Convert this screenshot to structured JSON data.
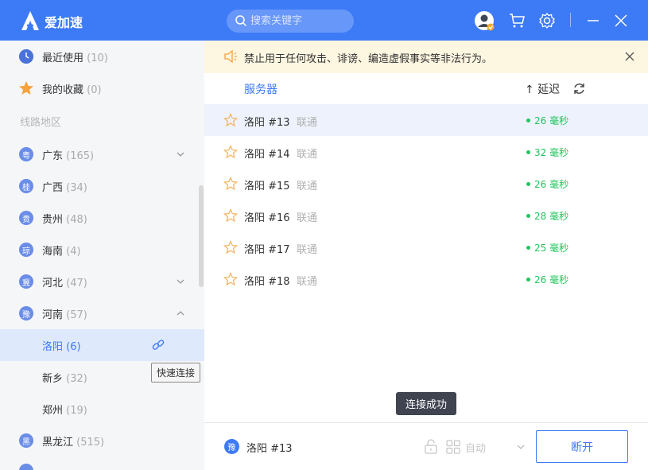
{
  "app": {
    "name": "爱加速"
  },
  "search": {
    "placeholder": "搜索关键字"
  },
  "sidebar": {
    "recent": {
      "label": "最近使用",
      "count": "(10)"
    },
    "favorites": {
      "label": "我的收藏",
      "count": "(0)"
    },
    "section_title": "线路地区",
    "regions": [
      {
        "badge": "粤",
        "label": "广东",
        "count": "(165)"
      },
      {
        "badge": "桂",
        "label": "广西",
        "count": "(34)"
      },
      {
        "badge": "贵",
        "label": "贵州",
        "count": "(48)"
      },
      {
        "badge": "琼",
        "label": "海南",
        "count": "(4)"
      },
      {
        "badge": "冀",
        "label": "河北",
        "count": "(47)"
      },
      {
        "badge": "豫",
        "label": "河南",
        "count": "(57)"
      },
      {
        "badge": "",
        "label": "洛阳",
        "count": "(6)"
      },
      {
        "badge": "",
        "label": "新乡",
        "count": "(32)"
      },
      {
        "badge": "",
        "label": "郑州",
        "count": "(19)"
      },
      {
        "badge": "黑",
        "label": "黑龙江",
        "count": "(515)"
      }
    ],
    "tooltip": "快速连接"
  },
  "notice": {
    "text": "禁止用于任何攻击、诽谤、编造虚假事实等非法行为。"
  },
  "table": {
    "col_server": "服务器",
    "col_delay": "↑ 延迟",
    "rows": [
      {
        "name": "洛阳 #13",
        "isp": "联通",
        "latency": "26 毫秒"
      },
      {
        "name": "洛阳 #14",
        "isp": "联通",
        "latency": "32 毫秒"
      },
      {
        "name": "洛阳 #15",
        "isp": "联通",
        "latency": "26 毫秒"
      },
      {
        "name": "洛阳 #16",
        "isp": "联通",
        "latency": "28 毫秒"
      },
      {
        "name": "洛阳 #17",
        "isp": "联通",
        "latency": "25 毫秒"
      },
      {
        "name": "洛阳 #18",
        "isp": "联通",
        "latency": "26 毫秒"
      }
    ]
  },
  "toast": "连接成功",
  "bottom": {
    "badge": "豫",
    "current": "洛阳 #13",
    "mode": "自动",
    "disconnect": "断开"
  },
  "colors": {
    "brand": "#3d7af6",
    "latency": "#22c55e",
    "notice_bg": "#fdf6e1"
  }
}
